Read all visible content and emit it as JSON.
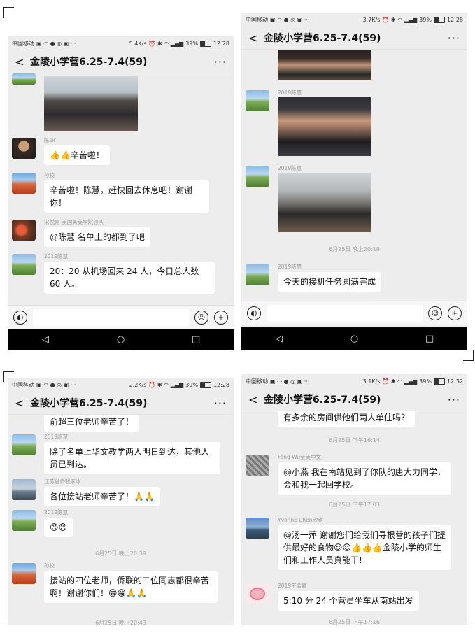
{
  "screens": [
    {
      "status": {
        "carrier": "中国移动",
        "net_speed": "5.4K/s",
        "battery_pct": "39%",
        "time": "12:28"
      },
      "title": "金陵小学营6.25-7.4(59)",
      "messages": [
        {
          "sender": "陈sir",
          "text": "👍👍辛苦啦！"
        },
        {
          "sender": "孙校",
          "text": "辛苦啦！陈慧，赶快回去休息吧！谢谢你！"
        },
        {
          "sender": "宋悦刚-美国菁英学院领队",
          "text": "@陈慧  名单上的都到了吧"
        },
        {
          "sender": "2019陈慧",
          "text": "20：20 从机场回来 24 人，今日总人数 60 人。"
        }
      ]
    },
    {
      "status": {
        "carrier": "中国移动",
        "net_speed": "3.7K/s",
        "battery_pct": "39%",
        "time": "12:28"
      },
      "title": "金陵小学营6.25-7.4(59)",
      "messages": [
        {
          "sender": "2019陈慧",
          "text": ""
        },
        {
          "sender": "2019陈慧",
          "text": ""
        },
        {
          "sender": "2019陈慧",
          "text": "今天的接机任务圆满完成"
        }
      ],
      "timestamps": [
        "6月25日 晚上20:19"
      ]
    },
    {
      "status": {
        "carrier": "中国移动",
        "net_speed": "2.2K/s",
        "battery_pct": "39%",
        "time": "12:28"
      },
      "title": "金陵小学营6.25-7.4(59)",
      "messages": [
        {
          "sender": "",
          "text": "俞超三位老师辛苦了！"
        },
        {
          "sender": "2019陈慧",
          "text": "除了名单上华文教学两人明日到达，其他人员已到达。"
        },
        {
          "sender": "江苏省侨联李冰",
          "text": "各位接站老师辛苦了！🙏🙏"
        },
        {
          "sender": "2019陈慧",
          "text": "😊😊"
        },
        {
          "sender": "孙校",
          "text": "接站的四位老师，侨联的二位同志都很辛苦啊！谢谢你们！😁😁🙏🙏"
        }
      ],
      "timestamps": [
        "6月25日 晚上20:39",
        "6月25日 晚上20:43"
      ]
    },
    {
      "status": {
        "carrier": "中国移动",
        "net_speed": "3.1K/s",
        "battery_pct": "39%",
        "time": "12:32"
      },
      "title": "金陵小学营6.25-7.4(59)",
      "messages": [
        {
          "sender": "",
          "text": "有多余的房间供他们两人单住吗？"
        },
        {
          "sender": "Fang Wu全美中文",
          "text": "@小燕  我在南站见到了你队的唐大力同学，会和我一起回学校。"
        },
        {
          "sender": "Yvonne Chen欣欣",
          "text": "@汤一萍  谢谢您们给我们寻根营的孩子们提供最好的食物😍😍👍👍👍金陵小学的师生们和工作人员真能干!"
        },
        {
          "sender": "2019王孟颖",
          "text": "5:10 分 24 个营员坐车从南站出发"
        }
      ],
      "timestamps": [
        "6月25日 下午16:14",
        "6月25日 下午17:03",
        "6月25日 下午17:16"
      ]
    }
  ],
  "icons": [
    "back-arrow-icon",
    "more-icon",
    "voice-icon",
    "emoji-icon",
    "plus-icon",
    "nav-back-icon",
    "nav-home-icon",
    "nav-recent-icon"
  ]
}
